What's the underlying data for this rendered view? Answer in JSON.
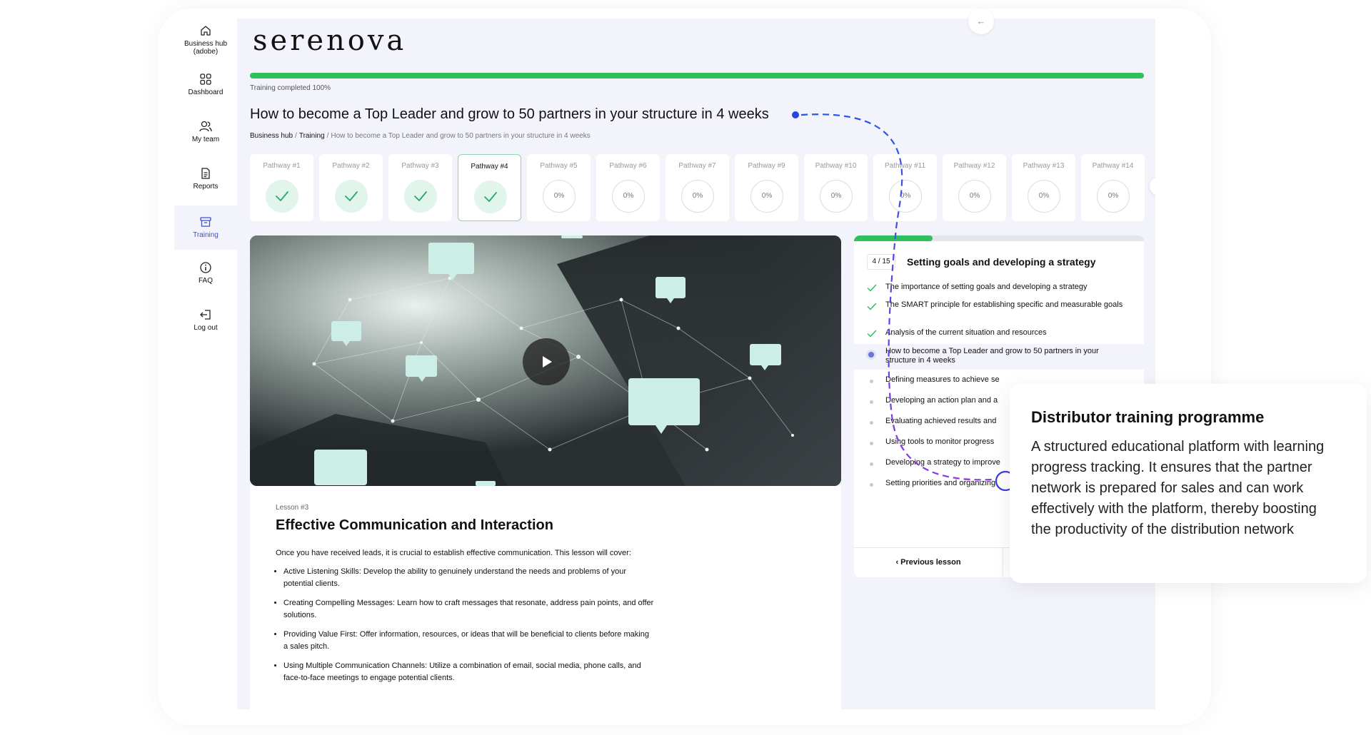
{
  "brand": {
    "logo": "serenova",
    "collapse_icon": "←"
  },
  "sidebar": {
    "items": [
      {
        "label": "Business hub (adobe)",
        "icon": "home-icon"
      },
      {
        "label": "Dashboard",
        "icon": "grid-icon"
      },
      {
        "label": "My team",
        "icon": "team-icon"
      },
      {
        "label": "Reports",
        "icon": "document-icon"
      },
      {
        "label": "Training",
        "icon": "archive-icon",
        "active": true
      },
      {
        "label": "FAQ",
        "icon": "info-icon"
      },
      {
        "label": "Log out",
        "icon": "logout-icon"
      }
    ]
  },
  "progress": {
    "label": "Training completed 100%",
    "value": 1.0,
    "color": "#2fbf5c"
  },
  "page": {
    "title": "How to become a Top Leader and grow to 50 partners in your structure in 4 weeks",
    "breadcrumb": [
      "Business hub",
      "Training",
      "How to become a Top Leader and grow to 50 partners in your structure in 4 weeks"
    ],
    "breadcrumb_sep": "/"
  },
  "pathways": [
    {
      "label": "Pathway #1",
      "status": "done"
    },
    {
      "label": "Pathway #2",
      "status": "done"
    },
    {
      "label": "Pathway #3",
      "status": "done"
    },
    {
      "label": "Pathway #4",
      "status": "done",
      "current": true
    },
    {
      "label": "Pathway #5",
      "status": "todo",
      "progress": "0%"
    },
    {
      "label": "Pathway #6",
      "status": "todo",
      "progress": "0%"
    },
    {
      "label": "Pathway #7",
      "status": "todo",
      "progress": "0%"
    },
    {
      "label": "Pathway #9",
      "status": "todo",
      "progress": "0%"
    },
    {
      "label": "Pathway #10",
      "status": "todo",
      "progress": "0%"
    },
    {
      "label": "Pathway #11",
      "status": "todo",
      "progress": "0%"
    },
    {
      "label": "Pathway #12",
      "status": "todo",
      "progress": "0%"
    },
    {
      "label": "Pathway #13",
      "status": "todo",
      "progress": "0%"
    },
    {
      "label": "Pathway #14",
      "status": "todo",
      "progress": "0%"
    }
  ],
  "pathways_next_icon": "›",
  "lesson": {
    "number": "Lesson #3",
    "title": "Effective Communication and Interaction",
    "intro": "Once you have received leads, it is crucial to establish effective communication. This lesson will cover:",
    "points": [
      "Active Listening Skills: Develop the ability to genuinely understand the needs and problems of your potential clients.",
      "Creating Compelling Messages: Learn how to craft messages that resonate, address pain points, and offer solutions.",
      "Providing Value First: Offer information, resources, or ideas that will be beneficial to clients before making a sales pitch.",
      "Using Multiple Communication Channels: Utilize a combination of email, social media, phone calls, and face-to-face meetings to engage potential clients."
    ]
  },
  "modules": {
    "count": "4 / 15",
    "progress": 0.27,
    "title": "Setting goals and developing a strategy",
    "items": [
      {
        "text": "The importance of setting goals and developing a strategy",
        "status": "done"
      },
      {
        "text": "The SMART principle for establishing specific and measurable goals",
        "status": "done"
      },
      {
        "text": "Analysis of the current situation and resources",
        "status": "done"
      },
      {
        "text": "How to become a Top Leader and grow to 50 partners in your structure in 4 weeks",
        "status": "current"
      },
      {
        "text": "Defining measures to achieve se",
        "status": "todo"
      },
      {
        "text": "Developing an action plan and a",
        "status": "todo"
      },
      {
        "text": "Evaluating achieved results and",
        "status": "todo"
      },
      {
        "text": "Using tools to monitor progress",
        "status": "todo"
      },
      {
        "text": "Developing a strategy to improve",
        "status": "todo"
      },
      {
        "text": "Setting priorities and organizing",
        "status": "todo"
      }
    ],
    "prev_label": "Previous lesson"
  },
  "callout": {
    "title": "Distributor training programme",
    "text": "A structured educational platform with learning progress tracking. It ensures that the partner network is prepared for sales and can work effectively with the platform, thereby boosting the productivity of the distribution network"
  },
  "colors": {
    "accent": "#3a4fd6",
    "success": "#2fbf5c",
    "connector": "#3b4de0"
  }
}
